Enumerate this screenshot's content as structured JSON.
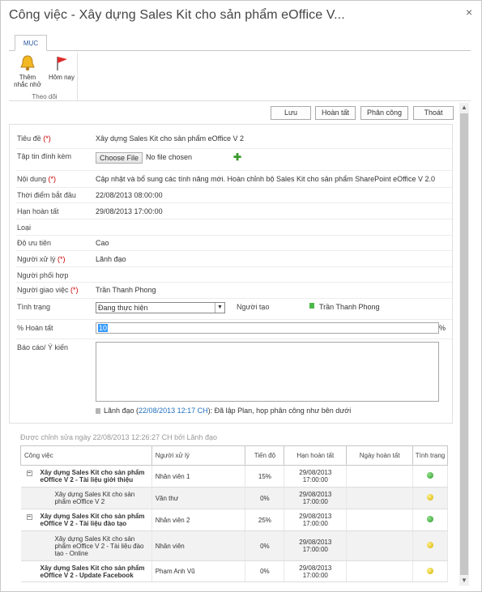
{
  "window": {
    "title": "Công việc - Xây dựng Sales Kit cho sản phẩm eOffice V...",
    "close_glyph": "×"
  },
  "ribbon": {
    "tab_label": "MỤC",
    "buttons": [
      {
        "label": "Thêm nhắc nhở",
        "icon": "bell-icon"
      },
      {
        "label": "Hôm nay",
        "icon": "flag-icon"
      }
    ],
    "group_label": "Theo dõi"
  },
  "toolbar": {
    "save": "Lưu",
    "complete": "Hoàn tất",
    "assign": "Phân công",
    "exit": "Thoát"
  },
  "form": {
    "title": {
      "label": "Tiêu đề",
      "required": "(*)",
      "value": "Xây dựng Sales Kit cho sản phẩm eOffice V 2"
    },
    "attachment": {
      "label": "Tập tin đính kèm",
      "button": "Choose File",
      "status": "No file chosen",
      "add_glyph": "✚"
    },
    "content": {
      "label": "Nội dung",
      "required": "(*)",
      "value": "Cập nhật và bổ sung các tính năng mới. Hoàn chỉnh bộ Sales Kit cho sản phẩm SharePoint eOffice V 2.0"
    },
    "start": {
      "label": "Thời điểm bắt đầu",
      "value": "22/08/2013 08:00:00"
    },
    "deadline": {
      "label": "Hạn hoàn tất",
      "value": "29/08/2013 17:00:00"
    },
    "type": {
      "label": "Loại",
      "value": ""
    },
    "priority": {
      "label": "Độ ưu tiên",
      "value": "Cao"
    },
    "handler": {
      "label": "Người xử lý",
      "required": "(*)",
      "value": "Lãnh đạo"
    },
    "coordinator": {
      "label": "Người phối hợp",
      "value": ""
    },
    "assigner": {
      "label": "Người giao việc",
      "required": "(*)",
      "value": "Trần Thanh Phong"
    },
    "status": {
      "label": "Tình trạng",
      "value": "Đang thực hiện",
      "creator_label": "Người tạo",
      "creator": "Trần Thanh Phong"
    },
    "percent": {
      "label": "% Hoàn tất",
      "value": "10",
      "unit": "%"
    },
    "report": {
      "label": "Báo cáo/ Ý kiến",
      "value": ""
    },
    "comment": {
      "author": "Lãnh đạo",
      "date": "22/08/2013 12:17 CH",
      "text": ": Đã lập Plan, họp phân công như bên dưới"
    }
  },
  "modified_note": "Được chỉnh sửa ngày 22/08/2013 12:26:27 CH bởi Lãnh đạo",
  "colors": {
    "status_green": "#2f9b2c",
    "status_yellow": "#d0b000",
    "required_red": "#c00000",
    "link_blue": "#1f6fbf"
  },
  "grid": {
    "headers": [
      "Công việc",
      "Người xử lý",
      "Tiến độ",
      "Hạn hoàn tất",
      "Ngày hoàn tất",
      "Tình trạng"
    ],
    "rows": [
      {
        "task": "Xây dựng Sales Kit cho sản phẩm eOffice V 2 - Tài liệu giới thiệu",
        "handler": "Nhân viên 1",
        "progress": "15%",
        "deadline": "29/08/2013 17:00:00",
        "done": "",
        "status": "green",
        "expander": "−"
      },
      {
        "task": "Xây dựng Sales Kit cho sản phẩm eOffice V 2",
        "handler": "Văn thư",
        "progress": "0%",
        "deadline": "29/08/2013 17:00:00",
        "done": "",
        "status": "yellow"
      },
      {
        "task": "Xây dựng Sales Kit cho sản phẩm eOffice V 2 - Tài liệu đào tạo",
        "handler": "Nhân viên 2",
        "progress": "25%",
        "deadline": "29/08/2013 17:00:00",
        "done": "",
        "status": "green",
        "expander": "−"
      },
      {
        "task": "Xây dựng Sales Kit cho sản phẩm eOffice V 2 - Tài liệu đào tạo - Online",
        "handler": "Nhân viên",
        "progress": "0%",
        "deadline": "29/08/2013 17:00:00",
        "done": "",
        "status": "yellow"
      },
      {
        "task": "Xây dựng Sales Kit cho sản phẩm eOffice V 2 - Update Facebook",
        "handler": "Phạm Anh Vũ",
        "progress": "0%",
        "deadline": "29/08/2013 17:00:00",
        "done": "",
        "status": "yellow"
      }
    ]
  }
}
